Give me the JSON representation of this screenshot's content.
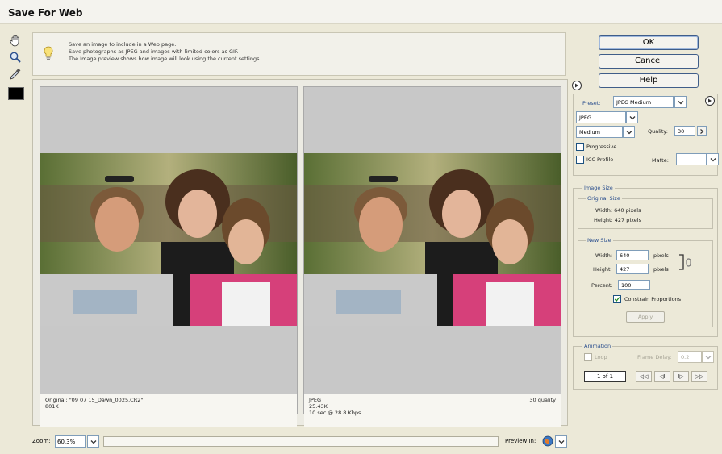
{
  "window": {
    "title": "Save For Web"
  },
  "info": {
    "lines": [
      "Save an image to include in a Web page.",
      "Save photographs as JPEG and images with limited colors as GIF.",
      "The Image preview shows how image will look using the current settings."
    ]
  },
  "panes": {
    "original": {
      "line1": "Original: \"09 07 15_Dawn_0025.CR2\"",
      "line2": "801K"
    },
    "optimized": {
      "line1": "JPEG",
      "line2": "25.43K",
      "line3": "10 sec @ 28.8 Kbps",
      "quality_note": "30 quality"
    }
  },
  "buttons": {
    "ok": "OK",
    "cancel": "Cancel",
    "help": "Help"
  },
  "settings": {
    "preset_label": "Preset:",
    "preset_value": "JPEG Medium",
    "format": "JPEG",
    "quality_level": "Medium",
    "quality_label": "Quality:",
    "quality_value": "30",
    "progressive_label": "Progressive",
    "icc_label": "ICC Profile",
    "matte_label": "Matte:"
  },
  "image_size": {
    "title": "Image Size",
    "original_title": "Original Size",
    "orig_width": "Width: 640 pixels",
    "orig_height": "Height: 427 pixels",
    "new_title": "New Size",
    "width_label": "Width:",
    "width_value": "640",
    "height_label": "Height:",
    "height_value": "427",
    "pixels_label": "pixels",
    "percent_label": "Percent:",
    "percent_value": "100",
    "constrain_label": "Constrain Proportions",
    "constrain_checked": true,
    "apply_label": "Apply"
  },
  "animation": {
    "title": "Animation",
    "loop_label": "Loop",
    "frame_delay_label": "Frame Delay:",
    "frame_delay_value": "0.2",
    "frame_counter": "1 of 1",
    "nav": [
      "◁◁",
      "◁I",
      "I▷",
      "▷▷"
    ]
  },
  "zoom": {
    "label": "Zoom:",
    "value": "60.3%"
  },
  "preview_in": {
    "label": "Preview In:"
  },
  "icons": [
    "hand-icon",
    "zoom-icon",
    "eyedropper-icon",
    "lightbulb-icon",
    "globe-icon",
    "chevron-down-icon",
    "menu-arrow-icon",
    "chain-link-icon"
  ]
}
